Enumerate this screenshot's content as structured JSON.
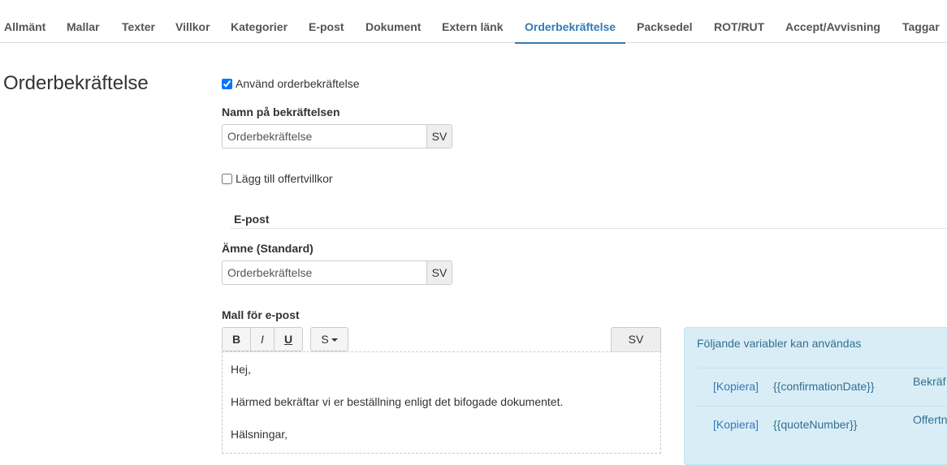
{
  "tabs": [
    {
      "label": "Allmänt",
      "active": false
    },
    {
      "label": "Mallar",
      "active": false
    },
    {
      "label": "Texter",
      "active": false
    },
    {
      "label": "Villkor",
      "active": false
    },
    {
      "label": "Kategorier",
      "active": false
    },
    {
      "label": "E-post",
      "active": false
    },
    {
      "label": "Dokument",
      "active": false
    },
    {
      "label": "Extern länk",
      "active": false
    },
    {
      "label": "Orderbekräftelse",
      "active": true
    },
    {
      "label": "Packsedel",
      "active": false
    },
    {
      "label": "ROT/RUT",
      "active": false
    },
    {
      "label": "Accept/Avvisning",
      "active": false
    },
    {
      "label": "Taggar",
      "active": false
    }
  ],
  "page_title": "Orderbekräftelse",
  "use_confirmation": {
    "label": "Använd orderbekräftelse",
    "checked": true
  },
  "name_field": {
    "label": "Namn på bekräftelsen",
    "value": "Orderbekräftelse",
    "lang": "SV"
  },
  "add_terms": {
    "label": "Lägg till offertvillkor",
    "checked": false
  },
  "email_section": {
    "title": "E-post"
  },
  "subject_field": {
    "label": "Ämne (Standard)",
    "value": "Orderbekräftelse",
    "lang": "SV"
  },
  "template_field": {
    "label": "Mall för e-post",
    "toolbar": {
      "bold": "B",
      "italic": "I",
      "underline": "U",
      "size": "S",
      "lang": "SV"
    },
    "body": [
      "Hej,",
      "Härmed bekräftar vi er beställning enligt det bifogade dokumentet.",
      "Hälsningar,"
    ]
  },
  "variables_panel": {
    "title": "Följande variabler kan användas",
    "rows": [
      {
        "copy": "[Kopiera]",
        "name": "{{confirmationDate}}",
        "desc": "Bekräf"
      },
      {
        "copy": "[Kopiera]",
        "name": "{{quoteNumber}}",
        "desc": "Offertn"
      }
    ]
  },
  "colors": {
    "accent": "#337ab7",
    "info_bg": "#d9edf7",
    "info_text": "#31708f"
  }
}
